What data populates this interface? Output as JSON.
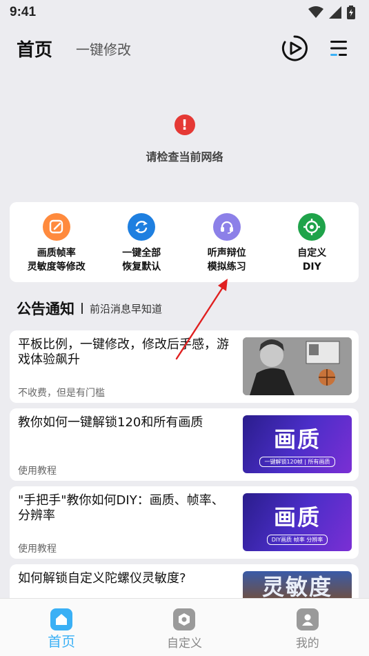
{
  "status_bar": {
    "time": "9:41"
  },
  "header": {
    "title": "首页",
    "tab": "一键修改"
  },
  "network_error": {
    "icon": "!",
    "message": "请检查当前网络"
  },
  "quick_actions": [
    {
      "label": "画质帧率\n灵敏度等修改",
      "icon": "edit-icon",
      "color": "#ff8a3d"
    },
    {
      "label": "一键全部\n恢复默认",
      "icon": "refresh-icon",
      "color": "#1e7fe0"
    },
    {
      "label": "听声辩位\n模拟练习",
      "icon": "headset-icon",
      "color": "#8c80e8"
    },
    {
      "label": "自定义\nDIY",
      "icon": "crosshair-icon",
      "color": "#1fa34a"
    }
  ],
  "section": {
    "title": "公告通知",
    "subtitle": "前沿消息早知道"
  },
  "articles": [
    {
      "title": "平板比例，一键修改，修改后手感，游戏体验飙升",
      "tag": "不收费，但是有门槛",
      "thumb": "photo"
    },
    {
      "title": "教你如何一键解锁120和所有画质",
      "tag": "使用教程",
      "thumb": "purple",
      "thumb_text": "画质",
      "thumb_sub": "一键解锁120帧 | 所有画质"
    },
    {
      "title": "\"手把手\"教你如何DIY：画质、帧率、分辨率",
      "tag": "使用教程",
      "thumb": "purple",
      "thumb_text": "画质",
      "thumb_sub": "DIY画质  帧率  分辨率"
    },
    {
      "title": "如何解锁自定义陀螺仪灵敏度?",
      "tag": "",
      "thumb": "orange",
      "thumb_text": "灵敏度"
    }
  ],
  "bottom_nav": [
    {
      "label": "首页",
      "icon": "home-icon",
      "active": true
    },
    {
      "label": "自定义",
      "icon": "hexagon-icon",
      "active": false
    },
    {
      "label": "我的",
      "icon": "user-icon",
      "active": false
    }
  ],
  "colors": {
    "accent": "#3ab0f5",
    "error": "#e53935"
  }
}
